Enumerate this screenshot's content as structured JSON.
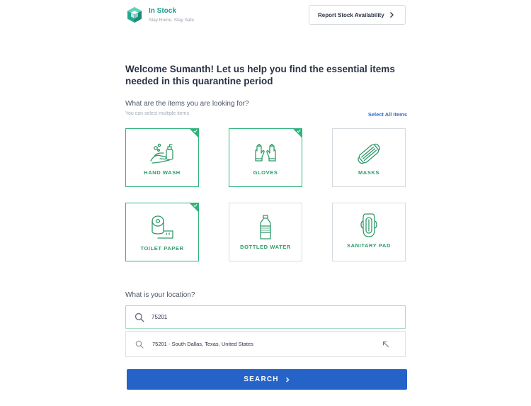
{
  "brand": {
    "title": "In Stock",
    "tagline": "Stay Home. Stay Safe",
    "logo_icon": "cube-icon",
    "colors": {
      "primary_green": "#2fb37c",
      "logo_teal": "#1a9e8a",
      "button_blue": "#2563c9"
    }
  },
  "header": {
    "report_button_label": "Report Stock Availability",
    "report_button_icon": "chevron-right-icon"
  },
  "welcome": {
    "heading": "Welcome Sumanth!  Let us help you find the essential items needed in this quarantine period"
  },
  "items_section": {
    "question": "What are the items you are looking for?",
    "hint": "You can select multiple items",
    "select_all_label": "Select All Items",
    "items": [
      {
        "label": "HAND WASH",
        "icon": "hand-wash-icon",
        "selected": true
      },
      {
        "label": "GLOVES",
        "icon": "gloves-icon",
        "selected": true
      },
      {
        "label": "MASKS",
        "icon": "mask-icon",
        "selected": false
      },
      {
        "label": "TOILET PAPER",
        "icon": "toilet-paper-icon",
        "selected": true
      },
      {
        "label": "BOTTLED WATER",
        "icon": "water-bottle-icon",
        "selected": false
      },
      {
        "label": "SANITARY PAD",
        "icon": "sanitary-pad-icon",
        "selected": false
      }
    ]
  },
  "location_section": {
    "question": "What is your location?",
    "input_value": "75201",
    "suggestion": "75201 - South Dallas, Texas, United States"
  },
  "search_button": {
    "label": "SEARCH",
    "icon": "chevron-right-icon"
  }
}
